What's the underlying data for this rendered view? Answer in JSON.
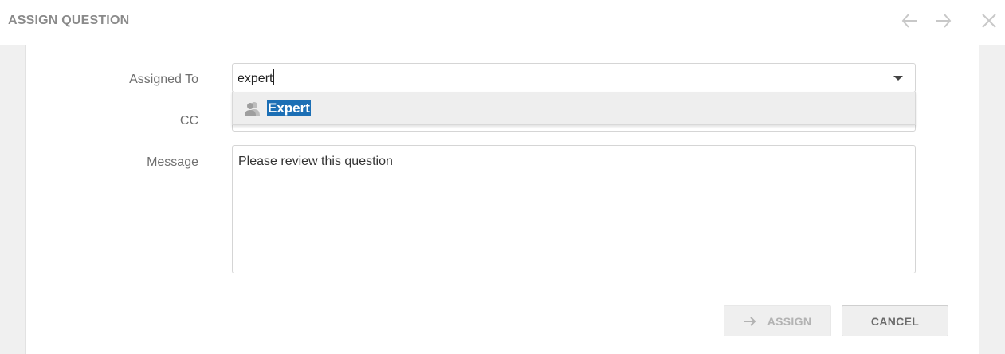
{
  "dialog": {
    "title": "ASSIGN QUESTION",
    "icons": {
      "back": "arrow-left-icon",
      "forward": "arrow-right-icon",
      "close": "close-icon"
    }
  },
  "form": {
    "assigned_to": {
      "label": "Assigned To",
      "value": "expert",
      "dropdown_options": [
        {
          "label": "Expert",
          "icon": "user-group-icon",
          "highlighted": true
        }
      ]
    },
    "cc": {
      "label": "CC"
    },
    "message": {
      "label": "Message",
      "value": "Please review this question"
    }
  },
  "actions": {
    "assign": {
      "label": "ASSIGN",
      "icon": "arrow-right-icon",
      "enabled": false
    },
    "cancel": {
      "label": "CANCEL"
    }
  },
  "colors": {
    "highlight": "#1c6fb5",
    "muted_text": "#8a8a8a"
  }
}
